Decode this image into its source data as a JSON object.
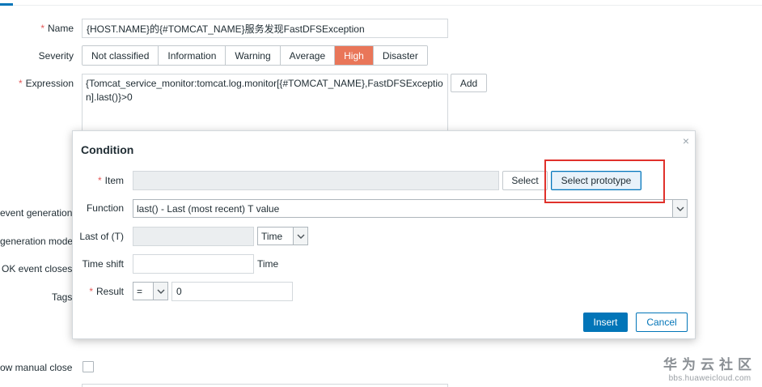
{
  "form": {
    "name_label": "Name",
    "name_value": "{HOST.NAME}的{#TOMCAT_NAME}服务发现FastDFSException",
    "severity_label": "Severity",
    "severity_options": [
      "Not classified",
      "Information",
      "Warning",
      "Average",
      "High",
      "Disaster"
    ],
    "severity_selected": "High",
    "expression_label": "Expression",
    "expression_value": "{Tomcat_service_monitor:tomcat.log.monitor[{#TOMCAT_NAME},FastDFSException].last()}>0",
    "add_label": "Add",
    "ok_event_generation_label": "event generation",
    "ok_event_generation_mode_label": "generation mode",
    "ok_event_closes_label": "OK event closes",
    "tags_label": "Tags",
    "allow_manual_close_label": "ow manual close"
  },
  "dialog": {
    "title": "Condition",
    "close_icon": "×",
    "item_label": "Item",
    "item_value": "",
    "select_label": "Select",
    "select_prototype_label": "Select prototype",
    "function_label": "Function",
    "function_value": "last() - Last (most recent) T value",
    "last_of_label": "Last of (T)",
    "last_of_value": "",
    "last_of_unit": "Time",
    "time_shift_label": "Time shift",
    "time_shift_value": "",
    "time_shift_unit": "Time",
    "result_label": "Result",
    "result_operator": "=",
    "result_value": "0",
    "insert_label": "Insert",
    "cancel_label": "Cancel"
  },
  "watermark": {
    "cn": "华为云社区",
    "url": "bbs.huaweicloud.com"
  },
  "colors": {
    "accent": "#0275b8",
    "severity_high": "#e97659",
    "required": "#e45959",
    "highlight": "#e0312b"
  }
}
